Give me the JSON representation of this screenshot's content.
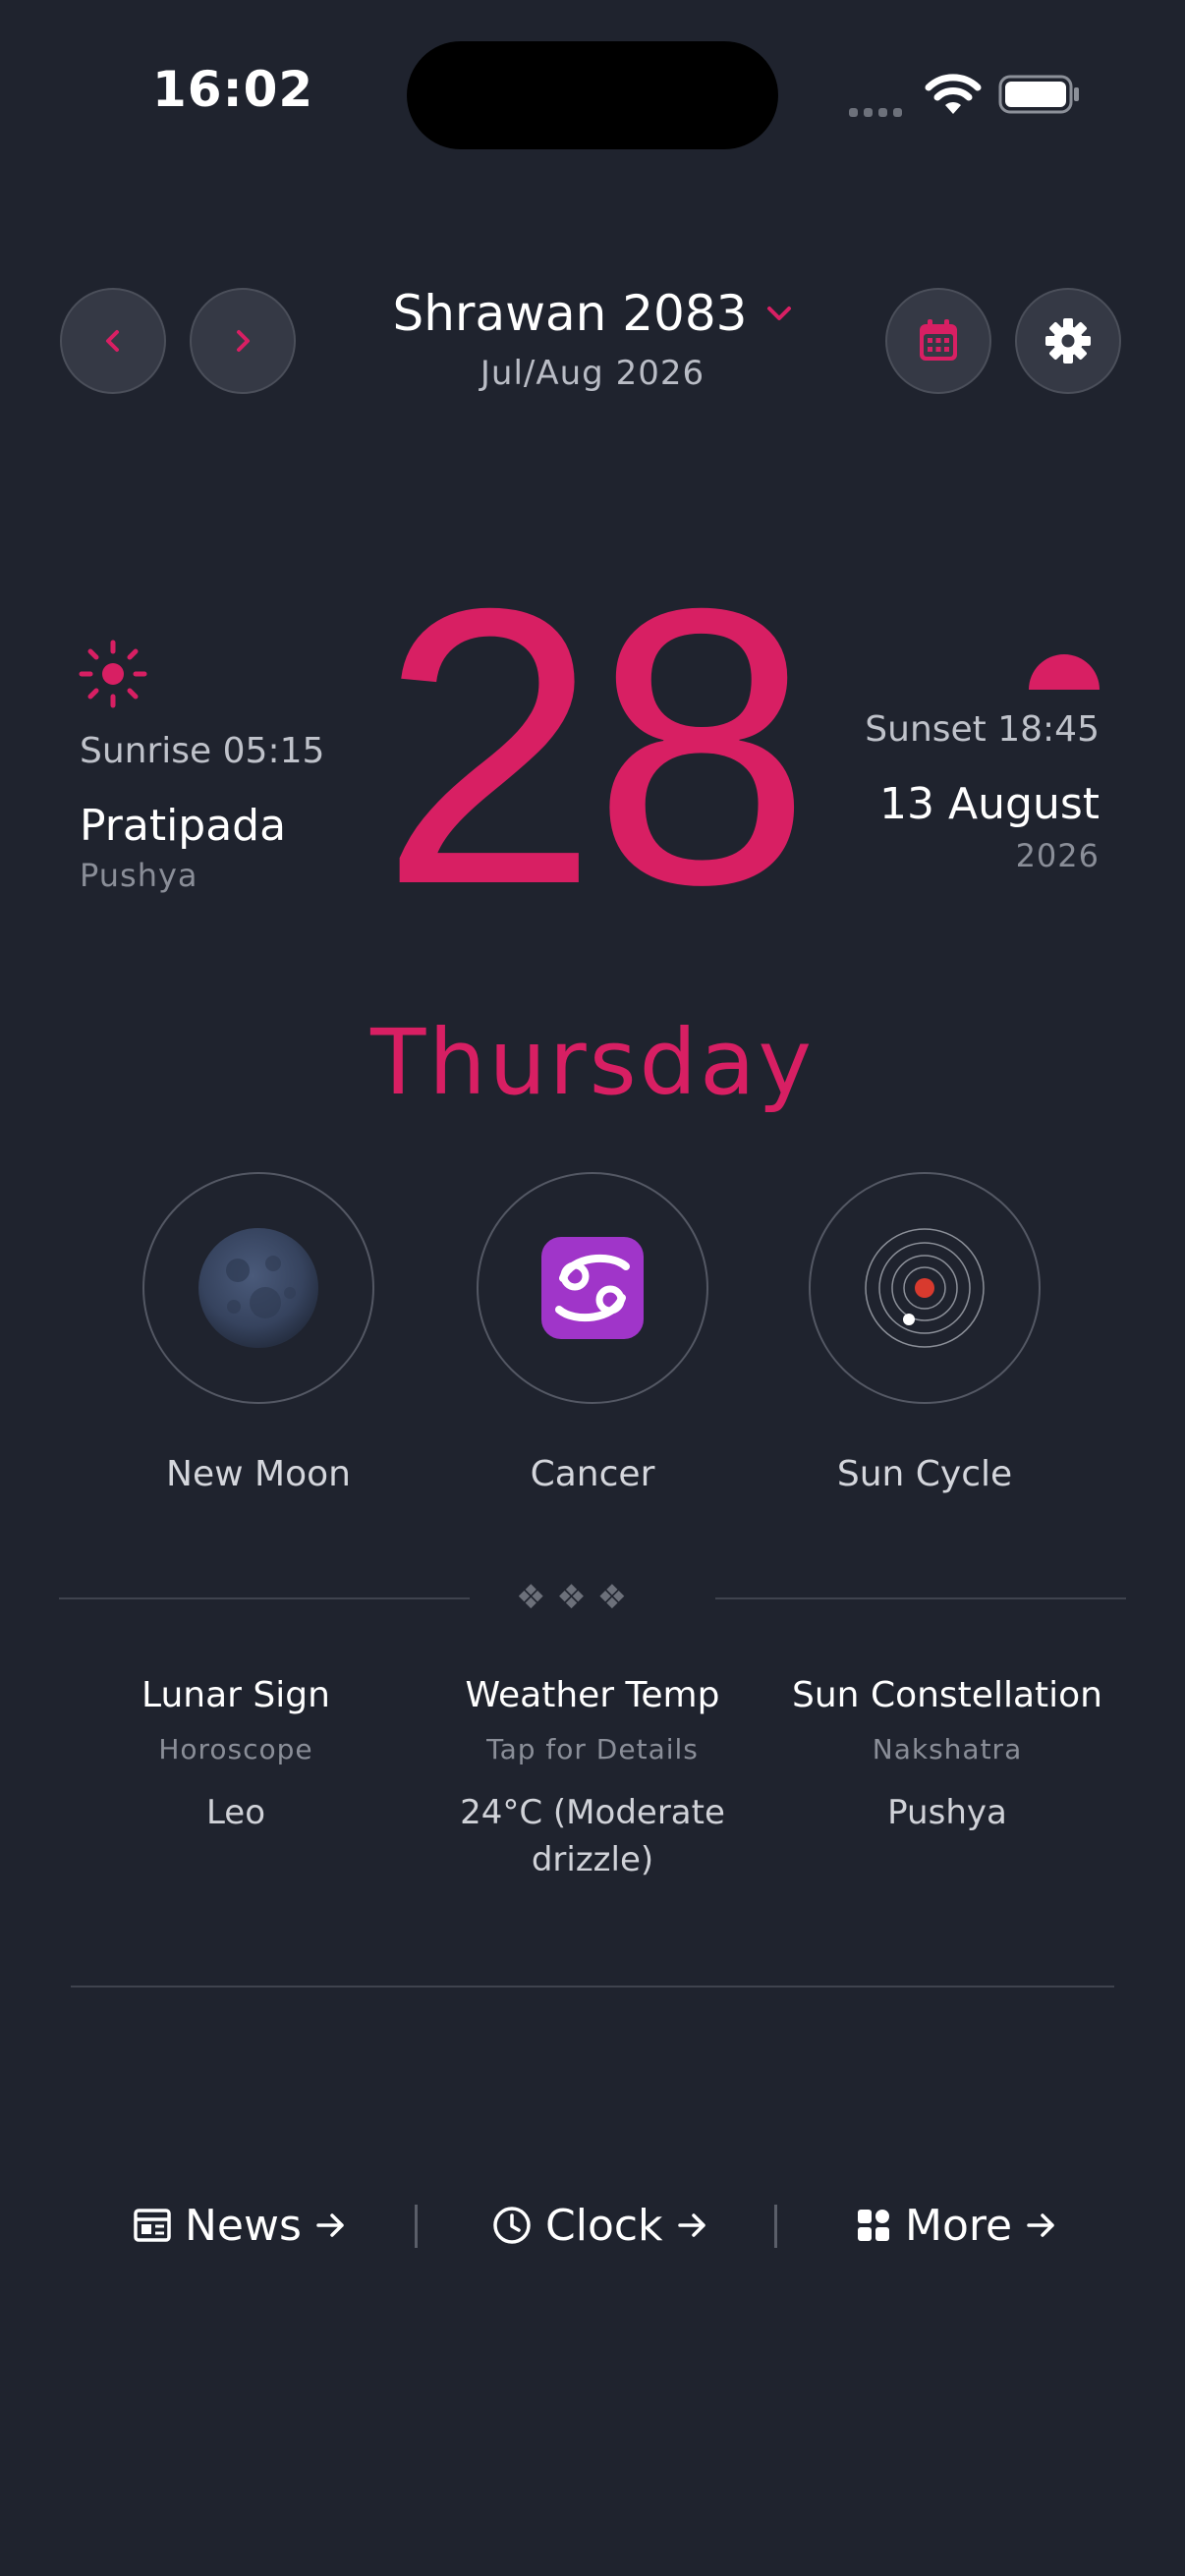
{
  "status_bar": {
    "time": "16:02"
  },
  "header": {
    "month_title": "Shrawan 2083",
    "month_subtitle": "Jul/Aug 2026",
    "prev_icon": "chevron-left-icon",
    "next_icon": "chevron-right-icon",
    "calendar_icon": "calendar-icon",
    "settings_icon": "gear-icon"
  },
  "today": {
    "day_number": "28",
    "weekday": "Thursday",
    "sunrise": "Sunrise 05:15",
    "tithi": "Pratipada",
    "nakshatra": "Pushya",
    "sunset": "Sunset 18:45",
    "gregorian_date": "13 August",
    "gregorian_year": "2026"
  },
  "highlights": [
    {
      "label": "New Moon",
      "icon": "moon-icon"
    },
    {
      "label": "Cancer",
      "icon": "cancer-zodiac-icon",
      "glyph": "♋"
    },
    {
      "label": "Sun Cycle",
      "icon": "sun-cycle-icon"
    }
  ],
  "divider": {
    "ornament": "❖ ❖ ❖"
  },
  "info": [
    {
      "title": "Lunar Sign",
      "subtitle": "Horoscope",
      "value": "Leo"
    },
    {
      "title": "Weather Temp",
      "subtitle": "Tap for Details",
      "value": "24°C (Moderate drizzle)"
    },
    {
      "title": "Sun Constellation",
      "subtitle": "Nakshatra",
      "value": "Pushya"
    }
  ],
  "bottom_nav": [
    {
      "label": "News",
      "icon": "newspaper-icon"
    },
    {
      "label": "Clock",
      "icon": "clock-icon"
    },
    {
      "label": "More",
      "icon": "grid-icon"
    }
  ],
  "colors": {
    "background": "#1f232e",
    "accent": "#d81f63",
    "button_bg": "#353945"
  }
}
